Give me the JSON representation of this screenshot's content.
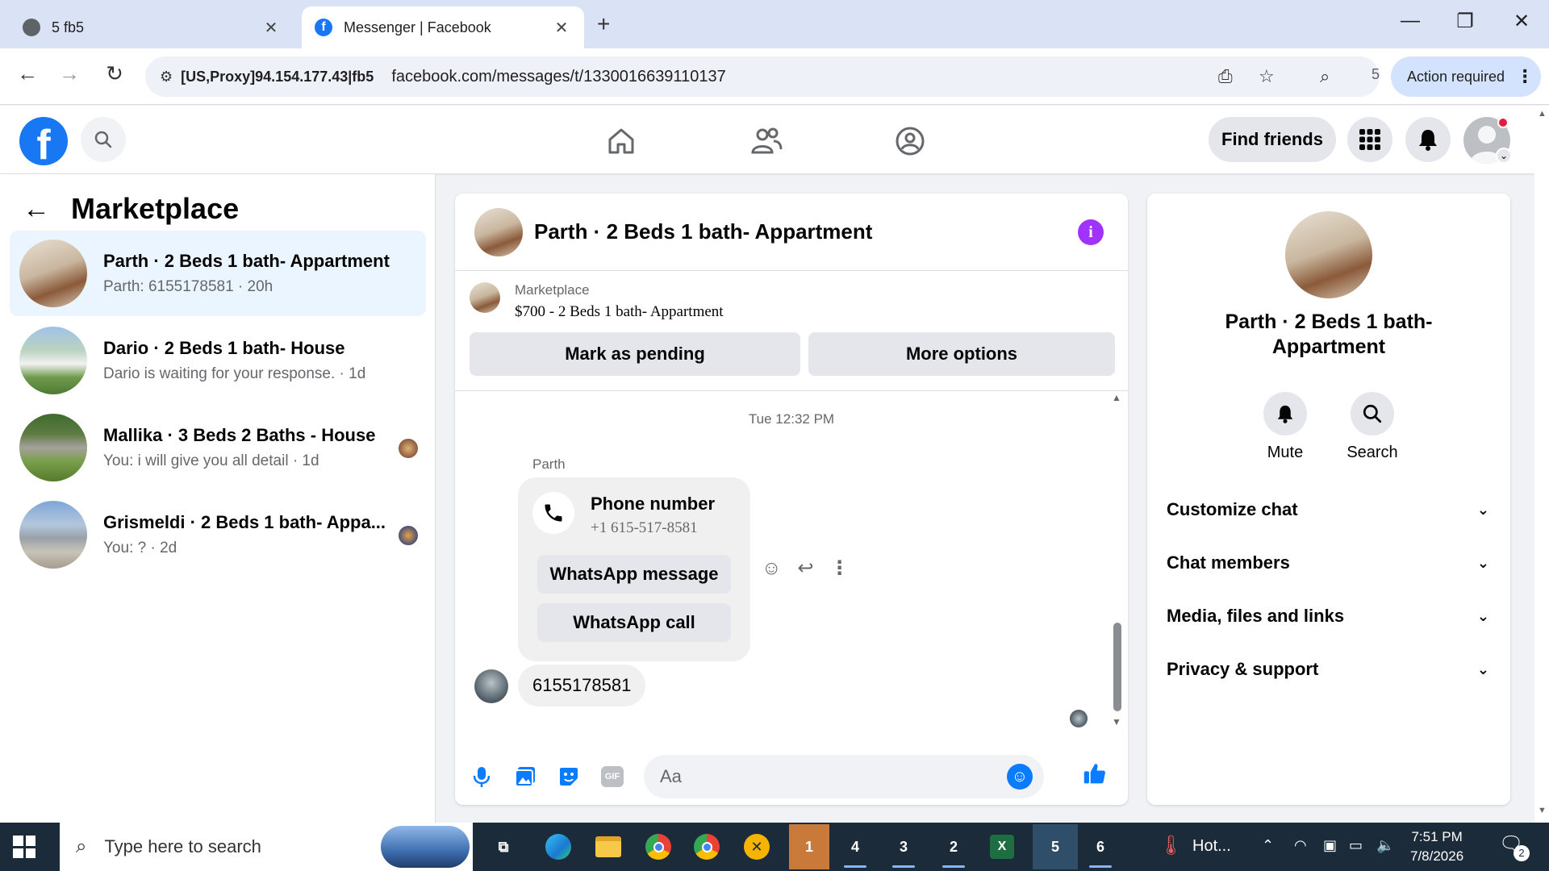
{
  "browser": {
    "tabs": [
      {
        "title": "5 fb5",
        "active": false
      },
      {
        "title": "Messenger | Facebook",
        "active": true
      }
    ],
    "proxy_label": "[US,Proxy]94.154.177.43|fb5",
    "url": "facebook.com/messages/t/1330016639110137",
    "counter": "5",
    "action_required": "Action required"
  },
  "fb_header": {
    "find_friends": "Find friends"
  },
  "marketplace": {
    "heading": "Marketplace",
    "conversations": [
      {
        "name": "Parth · 2 Beds 1 bath- Appartment",
        "preview": "Parth: 6155178581 · 20h",
        "active": true
      },
      {
        "name": "Dario · 2 Beds 1 bath- House",
        "preview": "Dario is waiting for your response. · 1d",
        "active": false
      },
      {
        "name": "Mallika · 3 Beds 2 Baths - House",
        "preview": "You: i will give you all detail · 1d",
        "active": false
      },
      {
        "name": "Grismeldi · 2 Beds 1 bath- Appa...",
        "preview": "You: ? · 2d",
        "active": false
      }
    ]
  },
  "chat": {
    "title": "Parth · 2 Beds 1 bath- Appartment",
    "marketplace_label": "Marketplace",
    "listing": "$700 - 2 Beds 1 bath- Appartment",
    "mark_pending": "Mark as pending",
    "more_options": "More options",
    "timestamp": "Tue 12:32 PM",
    "sender": "Parth",
    "phone_card": {
      "label": "Phone number",
      "value": "+1 615-517-8581",
      "whatsapp_message": "WhatsApp message",
      "whatsapp_call": "WhatsApp call"
    },
    "message": "6155178581",
    "composer_placeholder": "Aa"
  },
  "right_panel": {
    "name": "Parth · 2 Beds 1 bath- Appartment",
    "mute": "Mute",
    "search": "Search",
    "sections": [
      "Customize chat",
      "Chat members",
      "Media, files and links",
      "Privacy & support"
    ]
  },
  "taskbar": {
    "search_placeholder": "Type here to search",
    "weather": "Hot...",
    "time": "7:51 PM",
    "date": "7/8/2026",
    "notification_count": "2",
    "app_badges": [
      "1",
      "4",
      "3",
      "2",
      "5",
      "6"
    ]
  },
  "colors": {
    "fb_blue": "#1877f2",
    "messenger_blue": "#0a7cff",
    "info_purple": "#a033ff",
    "active_conv_bg": "#ebf5ff",
    "taskbar": "#1c2b3a"
  }
}
